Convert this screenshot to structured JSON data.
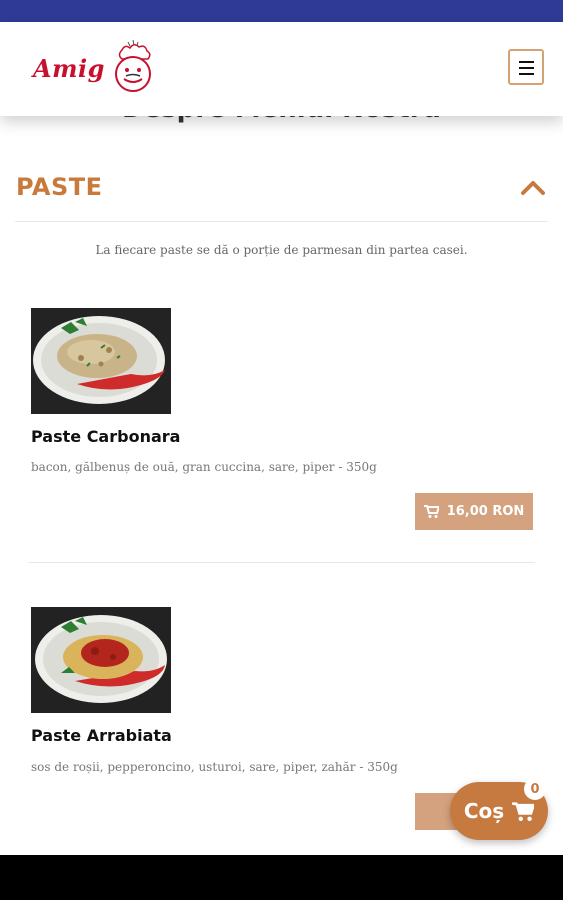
{
  "header": {
    "logo_text": "Amig",
    "menu_icon": "hamburger-icon"
  },
  "page": {
    "hidden_heading": "Despre Meniul Nostru"
  },
  "section": {
    "title": "PASTE",
    "toggle_icon": "chevron-up-icon",
    "note": "La fiecare paste se dă o porție de parmesan din partea casei."
  },
  "items": [
    {
      "name": "Paste Carbonara",
      "description": "bacon, gălbenuș de ouă, gran cuccina, sare, piper - 350g",
      "price": "16,00 RON",
      "cart_icon": "cart-icon"
    },
    {
      "name": "Paste Arrabiata",
      "description": "sos de roșii, pepperoncino, usturoi, sare, piper, zahăr - 350g",
      "price": "",
      "cart_icon": "cart-icon"
    }
  ],
  "cart": {
    "label": "Coș",
    "count": "0",
    "icon": "cart-icon"
  },
  "colors": {
    "status_bar": "#2f3a96",
    "accent": "#c87a3d",
    "button": "#d5a27f",
    "logo_red": "#c8102e"
  }
}
